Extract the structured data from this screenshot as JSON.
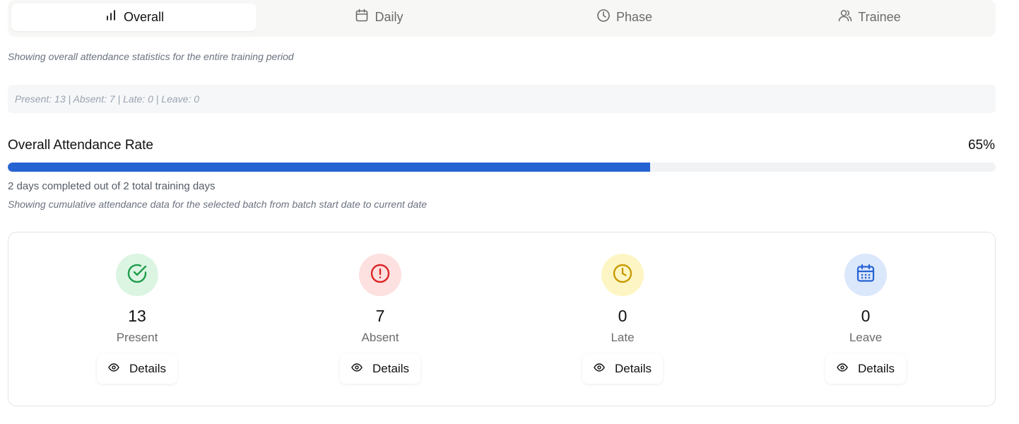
{
  "tabs": [
    {
      "label": "Overall",
      "icon": "bar-chart-icon",
      "active": true
    },
    {
      "label": "Daily",
      "icon": "calendar-icon",
      "active": false
    },
    {
      "label": "Phase",
      "icon": "clock-icon",
      "active": false
    },
    {
      "label": "Trainee",
      "icon": "users-icon",
      "active": false
    }
  ],
  "caption_overall": "Showing overall attendance statistics for the entire training period",
  "summary": "Present: 13 | Absent: 7 | Late: 0 | Leave: 0",
  "rate": {
    "title": "Overall Attendance Rate",
    "value": "65%",
    "fill_percent": 65,
    "days_text": "2 days completed out of 2 total training days",
    "caption": "Showing cumulative attendance data for the selected batch from batch start date to current date"
  },
  "stats": [
    {
      "count": "13",
      "label": "Present",
      "icon": "check-circle-icon",
      "bg": "#dcf5e3",
      "fg": "#1f9d4a",
      "details_label": "Details"
    },
    {
      "count": "7",
      "label": "Absent",
      "icon": "alert-circle-icon",
      "bg": "#fde0e0",
      "fg": "#dc2626",
      "details_label": "Details"
    },
    {
      "count": "0",
      "label": "Late",
      "icon": "clock-icon",
      "bg": "#fdf6c4",
      "fg": "#c99a06",
      "details_label": "Details"
    },
    {
      "count": "0",
      "label": "Leave",
      "icon": "calendar-icon",
      "bg": "#dbe7fb",
      "fg": "#2563d3",
      "details_label": "Details"
    }
  ],
  "colors": {
    "accent": "#2563d3",
    "track": "#f1f2f4"
  }
}
